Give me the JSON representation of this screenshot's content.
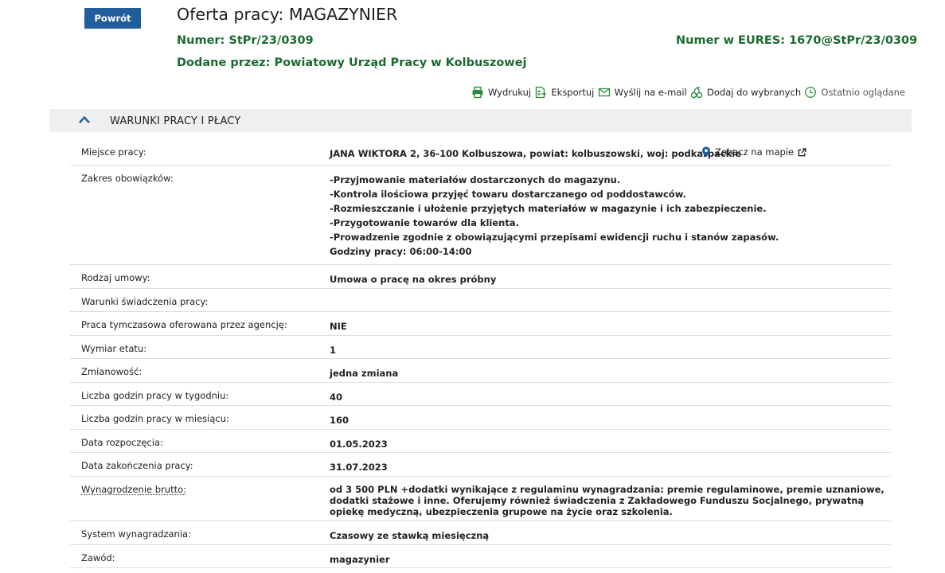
{
  "back_label": "Powrót",
  "title": "Oferta pracy: MAGAZYNIER",
  "number_line": "Numer: StPr/23/0309",
  "eures_line": "Numer w EURES: 1670@StPr/23/0309",
  "added_line": "Dodane przez: Powiatowy Urząd Pracy w Kolbuszowej",
  "toolbar": {
    "print": "Wydrukuj",
    "export": "Eksportuj",
    "email": "Wyślij na e-mail",
    "favorite": "Dodaj do wybranych",
    "recent": "Ostatnio oglądane"
  },
  "section": {
    "title": "WARUNKI PRACY I PŁACY"
  },
  "colors": {
    "accent": "#1f5d9c",
    "meta_green": "#1b6b2f",
    "icon_green": "#2e8b3e"
  },
  "rows": {
    "place": {
      "label": "Miejsce pracy:",
      "value": "JANA WIKTORA 2, 36-100 Kolbuszowa, powiat: kolbuszowski, woj: podkarpackie",
      "map_link": "Zobacz na mapie"
    },
    "duties": {
      "label": "Zakres obowiązków:",
      "lines": [
        "-Przyjmowanie materiałów dostarczonych do magazynu.",
        "-Kontrola ilościowa przyjęć towaru dostarczanego od poddostawców.",
        "-Rozmieszczanie i ułożenie przyjętych materiałów w magazynie i ich zabezpieczenie.",
        "-Przygotowanie towarów dla klienta.",
        "-Prowadzenie zgodnie z obowiązującymi przepisami ewidencji ruchu i stanów zapasów.",
        "Godziny pracy: 06:00-14:00"
      ]
    },
    "contract": {
      "label": "Rodzaj umowy:",
      "value": "Umowa o pracę na okres próbny"
    },
    "conditions": {
      "label": "Warunki świadczenia pracy:",
      "value": ""
    },
    "temp": {
      "label": "Praca tymczasowa oferowana przez agencję:",
      "value": "NIE"
    },
    "fte": {
      "label": "Wymiar etatu:",
      "value": "1"
    },
    "shifts": {
      "label": "Zmianowość:",
      "value": "jedna zmiana"
    },
    "hours_week": {
      "label": "Liczba godzin pracy w tygodniu:",
      "value": "40"
    },
    "hours_month": {
      "label": "Liczba godzin pracy w miesiącu:",
      "value": "160"
    },
    "start": {
      "label": "Data rozpoczęcia:",
      "value": "01.05.2023"
    },
    "end": {
      "label": "Data zakończenia pracy:",
      "value": "31.07.2023"
    },
    "salary": {
      "label": "Wynagrodzenie brutto:",
      "value": "od 3 500 PLN +dodatki wynikające z regulaminu wynagradzania: premie regulaminowe, premie uznaniowe, dodatki stażowe i inne. Oferujemy również świadczenia z Zakładowego Funduszu Socjalnego, prywatną opiekę medyczną, ubezpieczenia grupowe na życie oraz szkolenia."
    },
    "pay_system": {
      "label": "System wynagradzania:",
      "value": "Czasowy ze stawką miesięczną"
    },
    "occupation": {
      "label": "Zawód:",
      "value": "magazynier"
    }
  }
}
